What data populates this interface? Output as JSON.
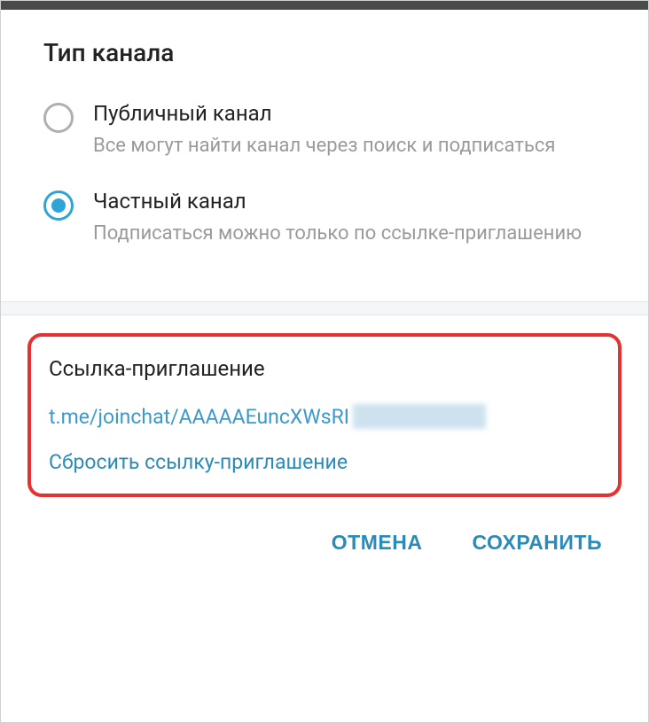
{
  "header": {
    "title": "Тип канала"
  },
  "options": {
    "public": {
      "label": "Публичный канал",
      "description": "Все могут найти канал через поиск и подписаться"
    },
    "private": {
      "label": "Частный канал",
      "description": "Подписаться можно только по ссылке-приглашению"
    }
  },
  "inviteSection": {
    "title": "Ссылка-приглашение",
    "link": "t.me/joinchat/AAAAAEuncXWsRI",
    "reset": "Сбросить ссылку-приглашение"
  },
  "buttons": {
    "cancel": "ОТМЕНА",
    "save": "СОХРАНИТЬ"
  }
}
